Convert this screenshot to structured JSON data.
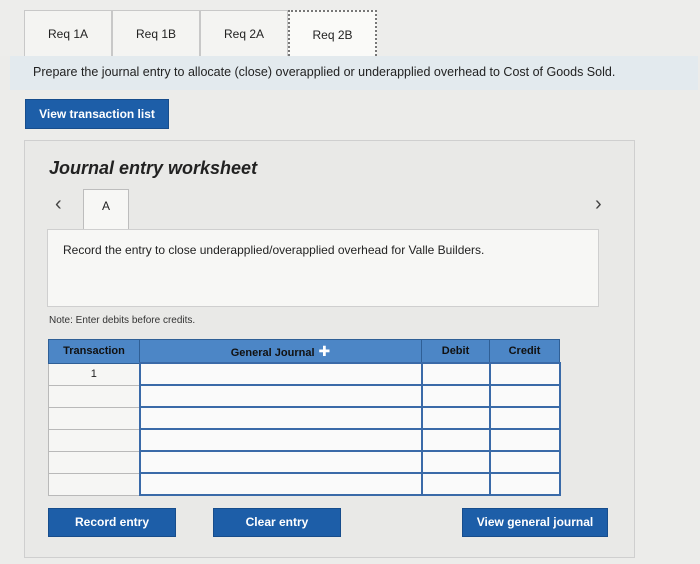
{
  "tabs": [
    {
      "label": "Req 1A"
    },
    {
      "label": "Req 1B"
    },
    {
      "label": "Req 2A"
    },
    {
      "label": "Req 2B"
    }
  ],
  "prompt": "Prepare the journal entry to allocate (close) overapplied or underapplied overhead to Cost of Goods Sold.",
  "view_transactions_label": "View transaction list",
  "worksheet": {
    "title": "Journal entry worksheet",
    "entry_tab": "A",
    "instruction": "Record the entry to close underapplied/overapplied overhead for Valle Builders.",
    "note": "Note: Enter debits before credits.",
    "columns": {
      "transaction": "Transaction",
      "general_journal": "General Journal",
      "debit": "Debit",
      "credit": "Credit"
    },
    "rows": [
      {
        "transaction": "1",
        "account": "",
        "debit": "",
        "credit": ""
      },
      {
        "transaction": "",
        "account": "",
        "debit": "",
        "credit": ""
      },
      {
        "transaction": "",
        "account": "",
        "debit": "",
        "credit": ""
      },
      {
        "transaction": "",
        "account": "",
        "debit": "",
        "credit": ""
      },
      {
        "transaction": "",
        "account": "",
        "debit": "",
        "credit": ""
      },
      {
        "transaction": "",
        "account": "",
        "debit": "",
        "credit": ""
      }
    ],
    "buttons": {
      "record": "Record entry",
      "clear": "Clear entry",
      "view_journal": "View general journal"
    }
  },
  "colors": {
    "accent": "#1d5ea8",
    "header": "#4c86c6"
  }
}
